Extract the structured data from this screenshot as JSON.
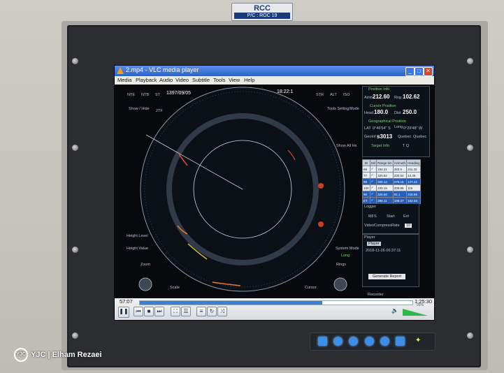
{
  "nameplate": {
    "line1": "RCC",
    "line2": "P/C : ROC 19"
  },
  "window": {
    "title": "2.mp4 - VLC media player",
    "buttons": {
      "minimize": "_",
      "maximize": "□",
      "close": "✕"
    }
  },
  "menu": [
    "Media",
    "Playback",
    "Audio",
    "Video",
    "Subtitle",
    "Tools",
    "View",
    "Help"
  ],
  "radar": {
    "date": "1397/09/05",
    "clock": "18:22:1",
    "tools_setting": "Tools Setting",
    "mode": "Mode",
    "show_hide": "Show / Hide",
    "show_all": "Show All Hs",
    "height_level": "Height Level",
    "height_value": "Height Value",
    "zoom": "Zoom",
    "scale": "Scale",
    "cursor": "Cursor",
    "system_mode": "System Mode",
    "system_mode_value": "Long",
    "rings": "Rings",
    "top_buttons": [
      "NTE",
      "NTB",
      "ST"
    ],
    "tool_buttons": [
      "STR",
      "ALT",
      "ISO"
    ],
    "ring_mark": "2TF"
  },
  "info": {
    "position_info": "Position Info",
    "azim_label": "Azim",
    "azim_value": "212.60",
    "rng_label": "Rng",
    "rng_value": "102.62",
    "cursor_position": "Cursor Position",
    "head_label": "Head",
    "head_value": "180.0",
    "dist_label": "Dist",
    "dist_value": "250.0",
    "geo_position": "Geographical Position",
    "lat_label": "LAT",
    "lat_value": "0°46'54\" S",
    "long_label": "Long",
    "long_value": "0°29'48\" W",
    "geoinfo_label": "GeoInf",
    "geoinfo_value": "s3013",
    "geoinfo_extra1": "Quebec",
    "geoinfo_extra2": "Quebec",
    "target_info": "Target Info",
    "tq_label": "T Q"
  },
  "target_table": {
    "headers": [
      "ID",
      "Sel",
      "Range km",
      "Azimuth",
      "Heading"
    ],
    "rows": [
      [
        "88",
        "✓",
        "154.21",
        "283.6",
        "211.42"
      ],
      [
        "77",
        "✓",
        "320.52",
        "230.54",
        "14.46"
      ],
      [
        "99",
        "✓",
        "320.14",
        "279.15",
        "127.22"
      ],
      [
        "100",
        "✓",
        "230.15",
        "208.85",
        "115"
      ],
      [
        "90",
        "✓",
        "326.50",
        "91.1",
        "215.68"
      ],
      [
        "ET",
        "✓",
        "295.11",
        "198.27",
        "162.33"
      ]
    ]
  },
  "lower_panel": {
    "logger": "Logger",
    "opt1": "MFS",
    "opt2": "Start",
    "opt3": "Ext",
    "video_compress": "VideoCompressRate",
    "video_compress_value": "10",
    "player": "Player",
    "player_label": "Player",
    "player_time": "2018-11-26 06:37:11",
    "generate": "Generate Report",
    "recorder": "Recorder"
  },
  "player": {
    "elapsed": "57:07",
    "total": "1:25:30",
    "progress": 0.67,
    "volume_pct": "95%",
    "volume_level": 0.95,
    "control_icons": [
      "pause-icon",
      "prev-icon",
      "stop-icon",
      "next-icon",
      "fullscreen-icon",
      "extended-icon",
      "playlist-icon",
      "loop-icon",
      "shuffle-icon"
    ]
  },
  "credit": {
    "logo": "YJC",
    "text": "YJC | Elham Rezaei"
  },
  "colors": {
    "vlc_blue": "#2c62c9",
    "radar_green": "#7fd27f",
    "accent_orange": "#e6792b",
    "keypad_blue": "#3f8fe6"
  }
}
